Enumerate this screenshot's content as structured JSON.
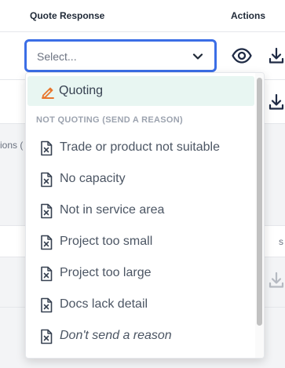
{
  "table": {
    "headers": {
      "quote_response": "Quote Response",
      "actions": "Actions"
    },
    "partial_left_text": "ions (",
    "partial_right_text": "s"
  },
  "select": {
    "placeholder": "Select...",
    "focus_color": "#3b6ee6",
    "icon": "chevron-down-icon"
  },
  "actions": {
    "view_icon": "eye-icon",
    "download_icon": "download-icon"
  },
  "menu": {
    "quoting": {
      "label": "Quoting",
      "icon": "pencil-icon",
      "icon_color": "#e8772e",
      "highlight_color": "#e8f6f2"
    },
    "group_label": "NOT QUOTING (SEND A REASON)",
    "reason_icon": "document-x-icon",
    "reasons": [
      {
        "label": "Trade or product not suitable"
      },
      {
        "label": "No capacity"
      },
      {
        "label": "Not in service area"
      },
      {
        "label": "Project too small"
      },
      {
        "label": "Project too large"
      },
      {
        "label": "Docs lack detail"
      },
      {
        "label": "Don't send a reason"
      }
    ]
  }
}
